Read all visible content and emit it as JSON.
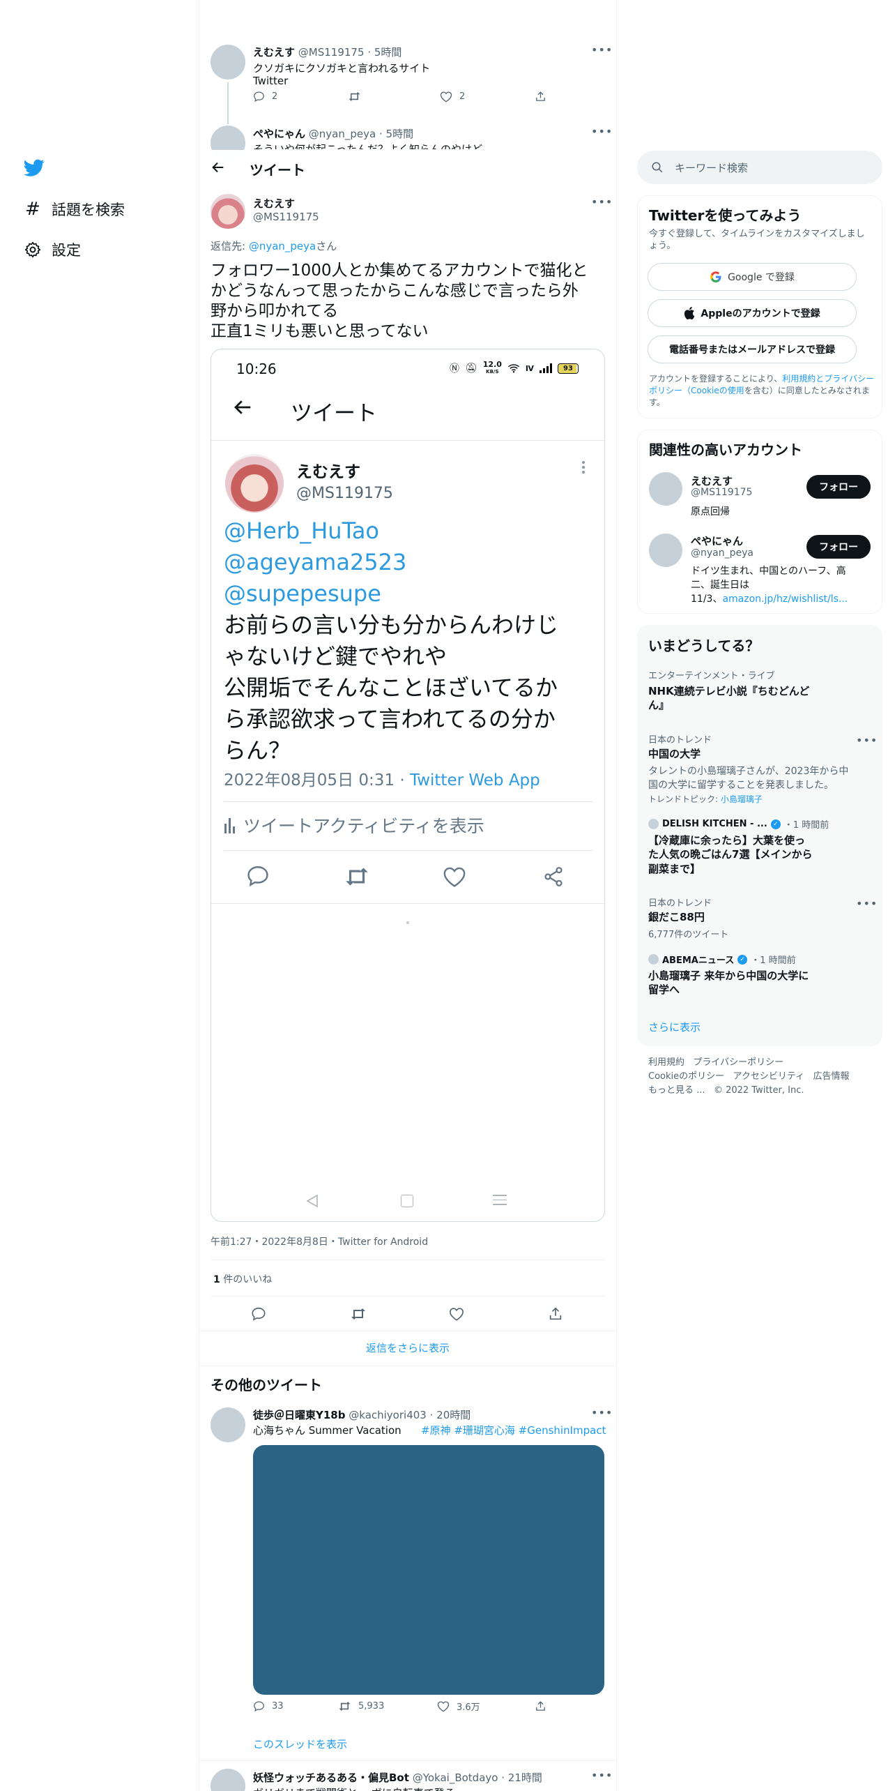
{
  "nav": {
    "explore_label": "話題を検索",
    "settings_label": "設定"
  },
  "header": {
    "title": "ツイート"
  },
  "top_tweets": [
    {
      "name": "えむえす",
      "handle": "@MS119175",
      "time": "5時間",
      "text_line1": "クソガキにクソガキと言われるサイト",
      "text_line2": "Twitter",
      "reply_count": "2",
      "like_count": "2"
    },
    {
      "name": "ぺやにゃん",
      "handle": "@nyan_peya",
      "time": "5時間",
      "text_partial": "そういや何が起こったんだ？よく知らんのやけど"
    }
  ],
  "main_tweet": {
    "name": "えむえす",
    "handle": "@MS119175",
    "reply_to_prefix": "返信先: ",
    "reply_to_handle": "@nyan_peya",
    "reply_to_suffix": "さん",
    "text_line1": "フォロワー1000人とか集めてるアカウントで猫化と",
    "text_line2": "かどうなんって思ったからこんな感じで言ったら外",
    "text_line3": "野から叩かれてる",
    "text_line4": "正直1ミリも悪いと思ってない",
    "timestamp": "午前1:27・2022年8月8日・Twitter for Android",
    "likes_count": "1",
    "likes_label": " 件のいいね",
    "show_more_replies": "返信をさらに表示"
  },
  "embedded_screenshot": {
    "status_time": "10:26",
    "status_speed": "12.0",
    "status_speed_unit": "KB/S",
    "battery": "93",
    "header_title": "ツイート",
    "name": "えむえす",
    "handle": "@MS119175",
    "mention1": "@Herb_HuTao",
    "mention2": "@ageyama2523",
    "mention3": "@supepesupe",
    "text_line1": "お前らの言い分も分からんわけじ",
    "text_line2": "ゃないけど鍵でやれや",
    "text_line3": "公開垢でそんなことほざいてるか",
    "text_line4": "ら承認欲求って言われてるの分か",
    "text_line5": "らん？",
    "timestamp": "2022年08月05日 0:31 · ",
    "source": "Twitter Web App",
    "activity_label": "ツイートアクティビティを表示"
  },
  "other_tweets": {
    "section_title": "その他のツイート",
    "tweet1": {
      "name": "徒歩＠日曜東Y18b",
      "handle": "@kachiyori403",
      "time": "20時間",
      "text": "心海ちゃん Summer Vacation",
      "hashtags": "#原神 #珊瑚宮心海 #GenshinImpact",
      "reply_count": "33",
      "retweet_count": "5,933",
      "like_count": "3.6万",
      "show_thread": "このスレッドを表示",
      "media_color": "#2a6384"
    },
    "tweet2": {
      "name": "妖怪ウォッチあるある・偏見Bot",
      "handle": "@Yokai_Botdayo",
      "time": "21時間",
      "text_partial": "ガリガリまで戦闘術と… ボに自転車で登る"
    }
  },
  "sidebar": {
    "search_placeholder": "キーワード検索",
    "signup": {
      "title": "Twitterを使ってみよう",
      "subtitle": "今すぐ登録して、タイムラインをカスタマイズしましょう。",
      "google_btn": "Google で登録",
      "apple_btn": "Appleのアカウントで登録",
      "phone_btn": "電話番号またはメールアドレスで登録",
      "terms_prefix": "アカウントを登録することにより、",
      "terms_link1": "利用規約とプライバシーポリシー（Cookieの使用",
      "terms_suffix": "を含む）に同意したとみなされます。"
    },
    "relevant": {
      "title": "関連性の高いアカウント",
      "accounts": [
        {
          "name": "えむえす",
          "handle": "@MS119175",
          "bio": "原点回帰",
          "follow": "フォロー"
        },
        {
          "name": "ぺやにゃん",
          "handle": "@nyan_peya",
          "bio_line1": "ドイツ生まれ、中国とのハーフ、高",
          "bio_line2": "二、誕生日は",
          "bio_line3": "11/3、",
          "bio_link": "amazon.jp/hz/wishlist/ls...",
          "follow": "フォロー"
        }
      ]
    },
    "trends": {
      "title": "いまどうしてる？",
      "items": [
        {
          "label": "エンターテインメント・ライブ",
          "title_line1": "NHK連続テレビ小説『ちむどんど",
          "title_line2": "ん』"
        },
        {
          "label": "日本のトレンド",
          "title_line1": "中国の大学",
          "desc_line1": "タレントの小島瑠璃子さんが、2023年から中",
          "desc_line2": "国の大学に留学することを発表しました。",
          "topic_prefix": "トレンドトピック: ",
          "topic_link": "小島瑠璃子"
        },
        {
          "source": "DELISH KITCHEN - ...",
          "time": "・1 時間前",
          "title_line1": "【冷蔵庫に余ったら】大葉を使っ",
          "title_line2": "た人気の晩ごはん7選【メインから",
          "title_line3": "副菜まで】"
        },
        {
          "label": "日本のトレンド",
          "title_line1": "銀だこ88円",
          "count": "6,777件のツイート"
        },
        {
          "source": "ABEMAニュース",
          "time": "・1 時間前",
          "title_line1": "小島瑠璃子 来年から中国の大学に",
          "title_line2": "留学へ"
        }
      ],
      "show_more": "さらに表示"
    },
    "footer": {
      "l1a": "利用規約",
      "l1b": "プライバシーポリシー",
      "l2a": "Cookieのポリシー",
      "l2b": "アクセシビリティ",
      "l2c": "広告情報",
      "l3a": "もっと見る ...",
      "l3b": "© 2022 Twitter, Inc."
    }
  }
}
